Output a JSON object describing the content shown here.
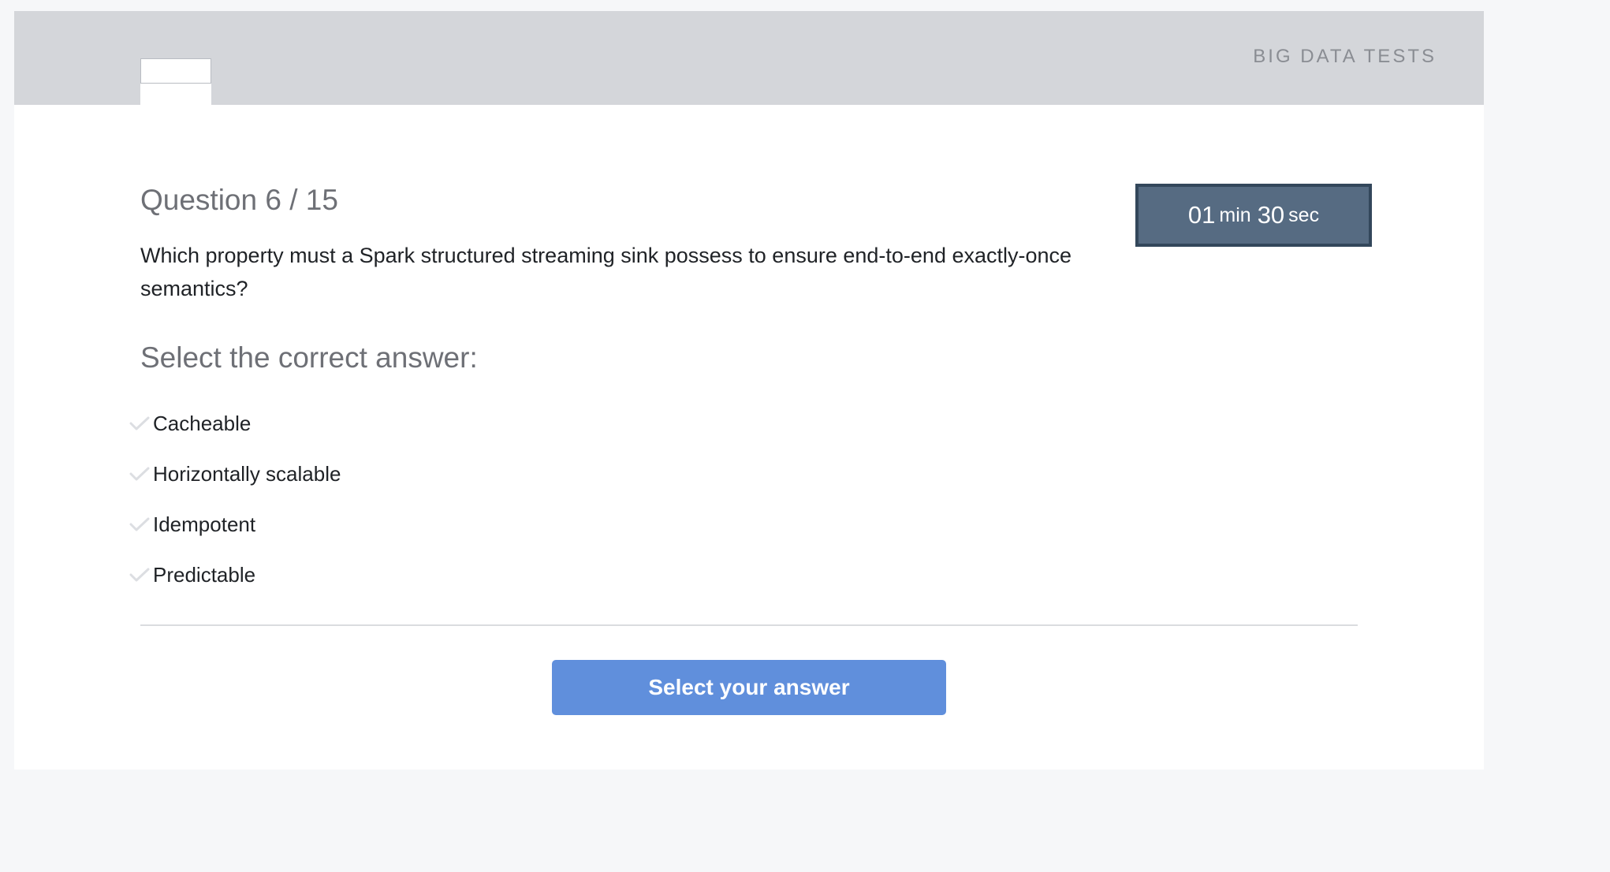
{
  "header": {
    "brand": "BIG DATA TESTS"
  },
  "question": {
    "title": "Question 6 / 15",
    "text": "Which property must a Spark structured streaming sink possess to ensure end-to-end exactly-once semantics?"
  },
  "timer": {
    "minutes": "01",
    "minutes_unit": "min",
    "seconds": "30",
    "seconds_unit": "sec"
  },
  "answers": {
    "prompt": "Select the correct answer:",
    "options": [
      {
        "label": "Cacheable"
      },
      {
        "label": "Horizontally scalable"
      },
      {
        "label": "Idempotent"
      },
      {
        "label": "Predictable"
      }
    ]
  },
  "submit": {
    "label": "Select your answer"
  },
  "colors": {
    "header_bg": "#d4d6da",
    "timer_bg": "#566b82",
    "timer_border": "#33475b",
    "button_bg": "#608fdc",
    "check_icon": "#dcdee2"
  },
  "icons": {
    "answer_marker": "check-icon"
  }
}
